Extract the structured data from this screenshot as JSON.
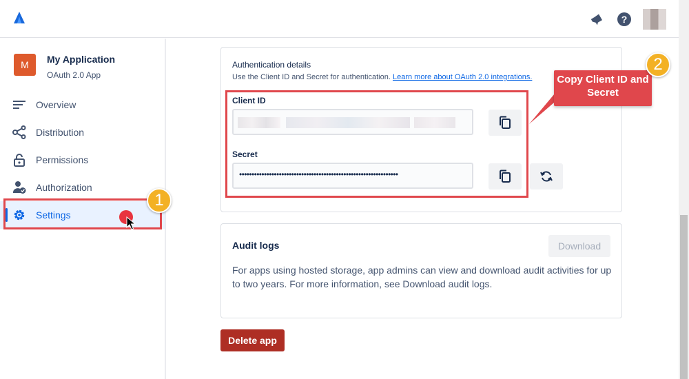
{
  "header": {
    "logo_icon": "atlassian-logo-icon",
    "icons": [
      "notification-bell-icon",
      "help-icon",
      "user-avatar"
    ]
  },
  "sidebar": {
    "app_initial": "M",
    "app_name": "My Application",
    "app_type": "OAuth 2.0 App",
    "items": [
      {
        "label": "Overview",
        "icon": "overview-icon"
      },
      {
        "label": "Distribution",
        "icon": "share-icon"
      },
      {
        "label": "Permissions",
        "icon": "lock-icon"
      },
      {
        "label": "Authorization",
        "icon": "user-check-icon"
      },
      {
        "label": "Settings",
        "icon": "gear-icon",
        "active": true
      }
    ]
  },
  "auth": {
    "title": "Authentication details",
    "description": "Use the Client ID and Secret for authentication.",
    "link": "Learn more about OAuth 2.0 integrations.",
    "client_id_label": "Client ID",
    "secret_label": "Secret",
    "secret_value": "••••••••••••••••••••••••••••••••••••••••••••••••••••••••••••••••",
    "copy_icon": "copy-icon",
    "refresh_icon": "refresh-icon"
  },
  "annotations": {
    "step1": "1",
    "step2": "2",
    "callout": "Copy Client ID and Secret",
    "accent": "#e0474c",
    "badge_color": "#f3b125"
  },
  "audit": {
    "title": "Audit logs",
    "download_label": "Download",
    "text": "For apps using hosted storage, app admins can view and download audit activities for up to two years. For more information, see Download audit logs."
  },
  "delete_label": "Delete app"
}
